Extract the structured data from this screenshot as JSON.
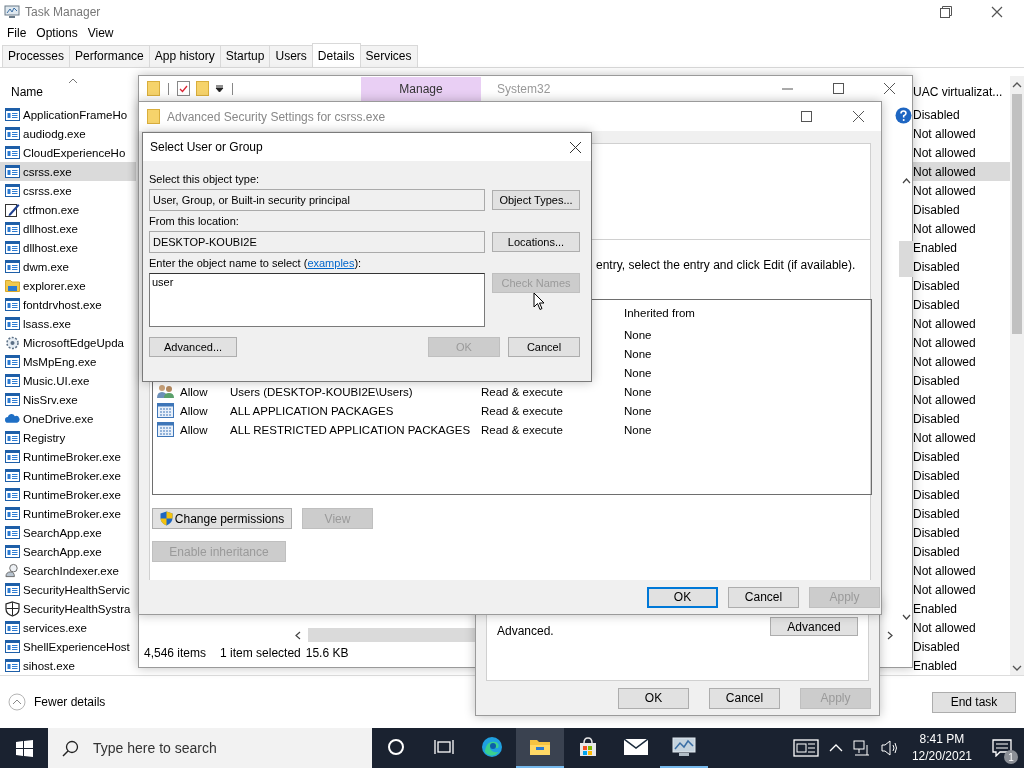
{
  "task_manager": {
    "title": "Task Manager",
    "menu": [
      "File",
      "Options",
      "View"
    ],
    "tabs": [
      {
        "label": "Processes",
        "selected": false
      },
      {
        "label": "Performance",
        "selected": false
      },
      {
        "label": "App history",
        "selected": false
      },
      {
        "label": "Startup",
        "selected": false
      },
      {
        "label": "Users",
        "selected": false
      },
      {
        "label": "Details",
        "selected": true
      },
      {
        "label": "Services",
        "selected": false
      }
    ],
    "columns": {
      "name": "Name",
      "column_2": "UAC virtualizat..."
    },
    "processes": [
      {
        "name": "ApplicationFrameHo",
        "kind": "app",
        "uac": "Disabled",
        "selected": false
      },
      {
        "name": "audiodg.exe",
        "kind": "app",
        "uac": "Not allowed",
        "selected": false
      },
      {
        "name": "CloudExperienceHo",
        "kind": "app",
        "uac": "Not allowed",
        "selected": false
      },
      {
        "name": "csrss.exe",
        "kind": "app",
        "uac": "Not allowed",
        "selected": true
      },
      {
        "name": "csrss.exe",
        "kind": "app",
        "uac": "Not allowed",
        "selected": false
      },
      {
        "name": "ctfmon.exe",
        "kind": "pen",
        "uac": "Disabled",
        "selected": false
      },
      {
        "name": "dllhost.exe",
        "kind": "app",
        "uac": "Not allowed",
        "selected": false
      },
      {
        "name": "dllhost.exe",
        "kind": "app",
        "uac": "Enabled",
        "selected": false
      },
      {
        "name": "dwm.exe",
        "kind": "app",
        "uac": "Disabled",
        "selected": false
      },
      {
        "name": "explorer.exe",
        "kind": "folder",
        "uac": "Disabled",
        "selected": false
      },
      {
        "name": "fontdrvhost.exe",
        "kind": "app",
        "uac": "Disabled",
        "selected": false
      },
      {
        "name": "lsass.exe",
        "kind": "app",
        "uac": "Not allowed",
        "selected": false
      },
      {
        "name": "MicrosoftEdgeUpda",
        "kind": "updater",
        "uac": "Not allowed",
        "selected": false
      },
      {
        "name": "MsMpEng.exe",
        "kind": "app",
        "uac": "Not allowed",
        "selected": false
      },
      {
        "name": "Music.UI.exe",
        "kind": "app",
        "uac": "Disabled",
        "selected": false
      },
      {
        "name": "NisSrv.exe",
        "kind": "app",
        "uac": "Not allowed",
        "selected": false
      },
      {
        "name": "OneDrive.exe",
        "kind": "cloud",
        "uac": "Disabled",
        "selected": false
      },
      {
        "name": "Registry",
        "kind": "app",
        "uac": "Not allowed",
        "selected": false
      },
      {
        "name": "RuntimeBroker.exe",
        "kind": "app",
        "uac": "Disabled",
        "selected": false
      },
      {
        "name": "RuntimeBroker.exe",
        "kind": "app",
        "uac": "Disabled",
        "selected": false
      },
      {
        "name": "RuntimeBroker.exe",
        "kind": "app",
        "uac": "Disabled",
        "selected": false
      },
      {
        "name": "RuntimeBroker.exe",
        "kind": "app",
        "uac": "Disabled",
        "selected": false
      },
      {
        "name": "SearchApp.exe",
        "kind": "app",
        "uac": "Disabled",
        "selected": false
      },
      {
        "name": "SearchApp.exe",
        "kind": "app",
        "uac": "Disabled",
        "selected": false
      },
      {
        "name": "SearchIndexer.exe",
        "kind": "indexer",
        "uac": "Not allowed",
        "selected": false
      },
      {
        "name": "SecurityHealthServic",
        "kind": "app",
        "uac": "Not allowed",
        "selected": false
      },
      {
        "name": "SecurityHealthSystra",
        "kind": "shield",
        "uac": "Enabled",
        "selected": false
      },
      {
        "name": "services.exe",
        "kind": "app",
        "uac": "Not allowed",
        "selected": false
      },
      {
        "name": "ShellExperienceHost",
        "kind": "app",
        "uac": "Disabled",
        "selected": false
      },
      {
        "name": "sihost.exe",
        "kind": "app",
        "uac": "Enabled",
        "selected": false
      }
    ],
    "fewer_details": "Fewer details",
    "end_task": "End task"
  },
  "explorer": {
    "ribbon_tab": "Manage",
    "title": "System32",
    "item_count": "4,546 items",
    "selection": "1 item selected",
    "selection_size": "15.6 KB"
  },
  "properties": {
    "note": "Advanced.",
    "advanced_button": "Advanced",
    "buttons": [
      {
        "label": "OK",
        "disabled": false,
        "default": false
      },
      {
        "label": "Cancel",
        "disabled": false,
        "default": false
      },
      {
        "label": "Apply",
        "disabled": true,
        "default": false
      }
    ]
  },
  "advanced_security": {
    "title": "Advanced Security Settings for csrss.exe",
    "instruction": "entry, select the entry and click Edit (if available).",
    "inherited_header": "Inherited from",
    "entries": [
      {
        "inherited": "None"
      },
      {
        "inherited": "None"
      },
      {
        "inherited": "None"
      },
      {
        "kind": "users",
        "type": "Allow",
        "principal": "Users (DESKTOP-KOUBI2E\\Users)",
        "access": "Read & execute",
        "inherited": "None"
      },
      {
        "kind": "package",
        "type": "Allow",
        "principal": "ALL APPLICATION PACKAGES",
        "access": "Read & execute",
        "inherited": "None"
      },
      {
        "kind": "package",
        "type": "Allow",
        "principal": "ALL RESTRICTED APPLICATION PACKAGES",
        "access": "Read & execute",
        "inherited": "None"
      }
    ],
    "change_permissions": "Change permissions",
    "view": {
      "label": "View",
      "disabled": true
    },
    "enable_inheritance": {
      "label": "Enable inheritance",
      "disabled": true
    },
    "buttons": [
      {
        "label": "OK",
        "disabled": false,
        "default": true
      },
      {
        "label": "Cancel",
        "disabled": false,
        "default": false
      },
      {
        "label": "Apply",
        "disabled": true,
        "default": false
      }
    ]
  },
  "select_dialog": {
    "title": "Select User or Group",
    "object_type_label": "Select this object type:",
    "object_type": "User, Group, or Built-in security principal",
    "object_types_button": {
      "label": "Object Types...",
      "disabled": false
    },
    "location_label": "From this location:",
    "location": "DESKTOP-KOUBI2E",
    "locations_button": {
      "label": "Locations...",
      "disabled": false
    },
    "name_label_before": "Enter the object name to select (",
    "name_label_link": "examples",
    "name_label_after": "):",
    "name_value": "user",
    "check_names_button": {
      "label": "Check Names",
      "disabled": true
    },
    "buttons": [
      {
        "label": "Advanced...",
        "disabled": false
      },
      {
        "label": "OK",
        "disabled": true
      },
      {
        "label": "Cancel",
        "disabled": false
      }
    ]
  },
  "taskbar": {
    "search_placeholder": "Type here to search",
    "apps": [
      {
        "kind": "cortana",
        "open": false,
        "selected": false
      },
      {
        "kind": "taskview",
        "open": false,
        "selected": false
      },
      {
        "kind": "edge",
        "open": false,
        "selected": false
      },
      {
        "kind": "explorer",
        "open": true,
        "selected": true
      },
      {
        "kind": "store",
        "open": false,
        "selected": false
      },
      {
        "kind": "mail",
        "open": false,
        "selected": false
      },
      {
        "kind": "taskmgr",
        "open": true,
        "selected": false
      }
    ],
    "time": "8:41 PM",
    "date": "12/20/2021",
    "notifications": "1"
  }
}
